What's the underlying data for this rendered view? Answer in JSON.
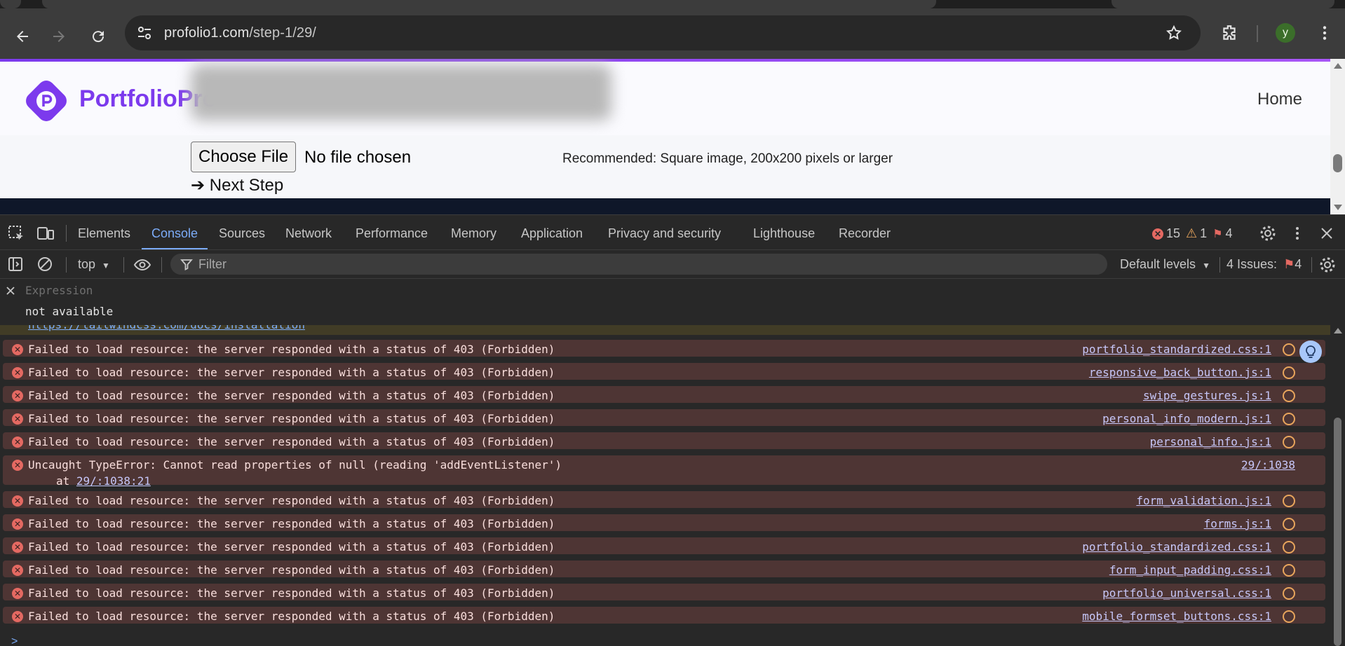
{
  "browser": {
    "url_host": "profolio1.com",
    "url_path": "/step-1/29/",
    "profile_initial": "y"
  },
  "page": {
    "brand": "PortfolioPro",
    "nav_home": "Home",
    "choose_file": "Choose File",
    "no_file": "No file chosen",
    "recommendation": "Recommended: Square image, 200x200 pixels or larger",
    "next_step": "➔ Next Step"
  },
  "devtools": {
    "tabs": [
      "Elements",
      "Console",
      "Sources",
      "Network",
      "Performance",
      "Memory",
      "Application",
      "Privacy and security",
      "Lighthouse",
      "Recorder"
    ],
    "active_tab": "Console",
    "error_count": "15",
    "warning_count": "1",
    "issue_count": "4",
    "context": "top",
    "filter_placeholder": "Filter",
    "levels": "Default levels",
    "issues_label": "4 Issues:",
    "issues_count": "4",
    "expression_placeholder": "Expression",
    "expression_value": "not available",
    "warning_link": "https://tailwindcss.com/docs/installation",
    "messages": [
      {
        "text": "Failed to load resource: the server responded with a status of 403 (Forbidden)",
        "source": "portfolio_standardized.css:1"
      },
      {
        "text": "Failed to load resource: the server responded with a status of 403 (Forbidden)",
        "source": "responsive_back_button.js:1"
      },
      {
        "text": "Failed to load resource: the server responded with a status of 403 (Forbidden)",
        "source": "swipe_gestures.js:1"
      },
      {
        "text": "Failed to load resource: the server responded with a status of 403 (Forbidden)",
        "source": "personal_info_modern.js:1"
      },
      {
        "text": "Failed to load resource: the server responded with a status of 403 (Forbidden)",
        "source": "personal_info.js:1"
      },
      {
        "text": "Uncaught TypeError: Cannot read properties of null (reading 'addEventListener')",
        "source": "29/:1038",
        "sub_prefix": "at ",
        "sub_link": "29/:1038:21"
      },
      {
        "text": "Failed to load resource: the server responded with a status of 403 (Forbidden)",
        "source": "form_validation.js:1"
      },
      {
        "text": "Failed to load resource: the server responded with a status of 403 (Forbidden)",
        "source": "forms.js:1"
      },
      {
        "text": "Failed to load resource: the server responded with a status of 403 (Forbidden)",
        "source": "portfolio_standardized.css:1"
      },
      {
        "text": "Failed to load resource: the server responded with a status of 403 (Forbidden)",
        "source": "form_input_padding.css:1"
      },
      {
        "text": "Failed to load resource: the server responded with a status of 403 (Forbidden)",
        "source": "portfolio_universal.css:1"
      },
      {
        "text": "Failed to load resource: the server responded with a status of 403 (Forbidden)",
        "source": "mobile_formset_buttons.css:1"
      }
    ],
    "prompt_symbol": ">"
  },
  "colors": {
    "brand": "#7c3aed",
    "active_tab": "#7cacf8",
    "error_row_bg": "#4e3534",
    "error_icon": "#e46962"
  }
}
